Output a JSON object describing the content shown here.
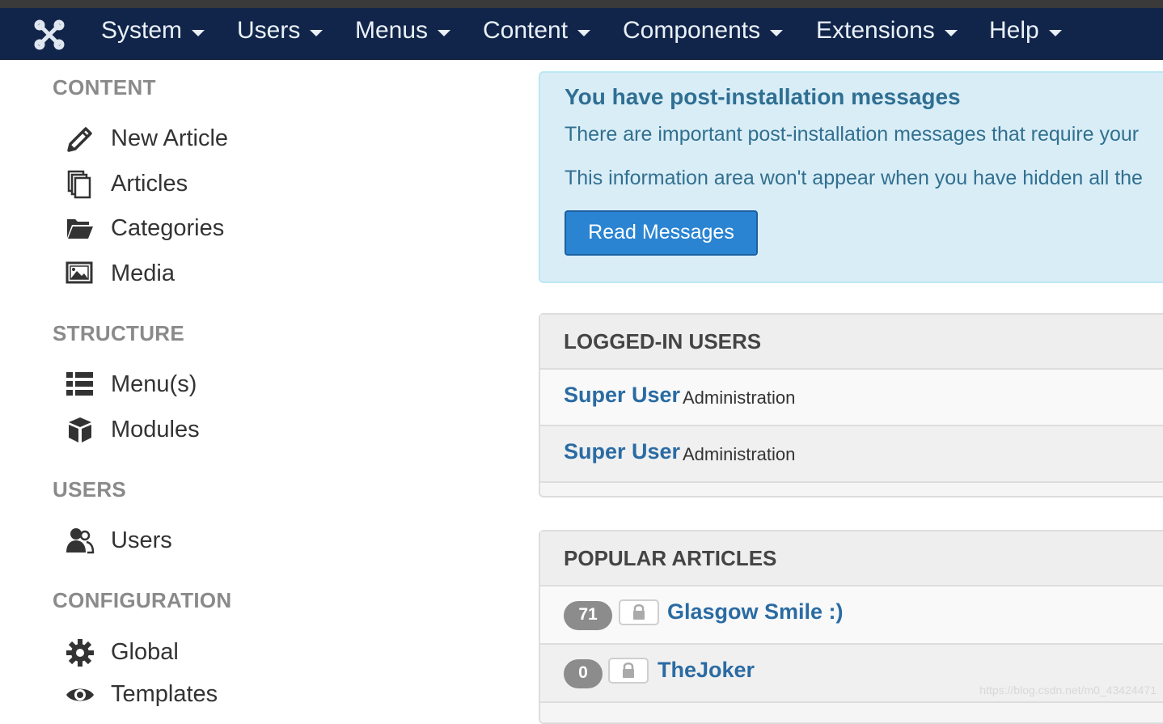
{
  "navbar": {
    "logo_icon": "joomla-logo-icon",
    "items": [
      {
        "label": "System"
      },
      {
        "label": "Users"
      },
      {
        "label": "Menus"
      },
      {
        "label": "Content"
      },
      {
        "label": "Components"
      },
      {
        "label": "Extensions"
      },
      {
        "label": "Help"
      }
    ]
  },
  "sidebar": {
    "sections": [
      {
        "heading": "CONTENT",
        "items": [
          {
            "label": "New Article",
            "icon": "pencil-icon"
          },
          {
            "label": "Articles",
            "icon": "copy-icon"
          },
          {
            "label": "Categories",
            "icon": "folder-icon"
          },
          {
            "label": "Media",
            "icon": "image-icon"
          }
        ]
      },
      {
        "heading": "STRUCTURE",
        "items": [
          {
            "label": "Menu(s)",
            "icon": "list-icon"
          },
          {
            "label": "Modules",
            "icon": "cube-icon"
          }
        ]
      },
      {
        "heading": "USERS",
        "items": [
          {
            "label": "Users",
            "icon": "users-icon"
          }
        ]
      },
      {
        "heading": "CONFIGURATION",
        "items": [
          {
            "label": "Global",
            "icon": "gear-icon"
          },
          {
            "label": "Templates",
            "icon": "eye-icon"
          }
        ]
      }
    ]
  },
  "alert": {
    "title": "You have post-installation messages",
    "line1": "There are important post-installation messages that require your",
    "line2": "This information area won't appear when you have hidden all the",
    "button": "Read Messages"
  },
  "logged_in": {
    "title": "LOGGED-IN USERS",
    "rows": [
      {
        "name": "Super User",
        "role": "Administration"
      },
      {
        "name": "Super User",
        "role": "Administration"
      }
    ]
  },
  "popular": {
    "title": "POPULAR ARTICLES",
    "rows": [
      {
        "hits": "71",
        "title": "Glasgow Smile :)"
      },
      {
        "hits": "0",
        "title": "TheJoker"
      }
    ]
  },
  "watermark": "https://blog.csdn.net/m0_43424471",
  "colors": {
    "navbar": "#11254a",
    "link": "#2a6ba3",
    "button": "#2a84d2",
    "alert_bg": "#d9edf7"
  }
}
